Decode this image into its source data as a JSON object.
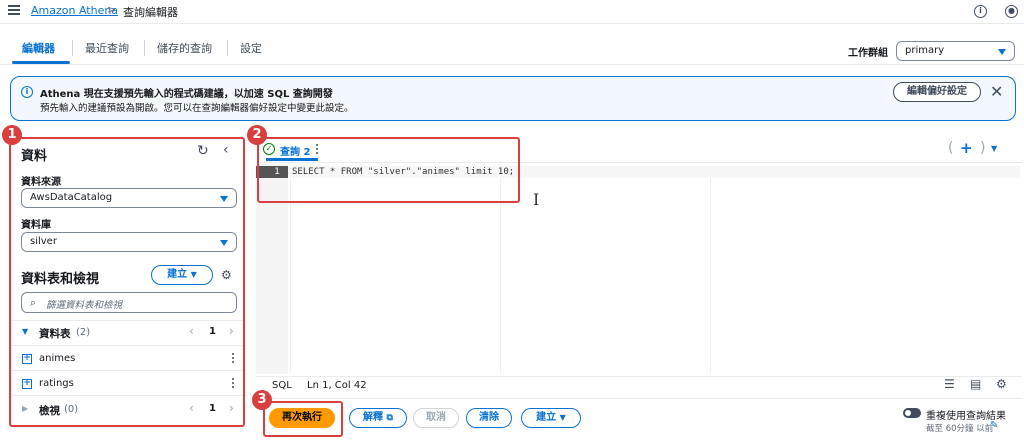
{
  "breadcrumb": {
    "service": "Amazon Athena",
    "separator": ">",
    "current": "查詢編輯器"
  },
  "tabs": [
    {
      "label": "編輯器",
      "active": true
    },
    {
      "label": "最近查詢",
      "active": false
    },
    {
      "label": "儲存的查詢",
      "active": false
    },
    {
      "label": "設定",
      "active": false
    }
  ],
  "workgroup": {
    "label": "工作群組",
    "value": "primary"
  },
  "alert": {
    "title": "Athena 現在支援預先輸入的程式碼建議，以加速 SQL 查詢開發",
    "body": "預先輸入的建議預設為開啟。您可以在查詢編輯器偏好設定中變更此設定。",
    "button": "編輯偏好設定"
  },
  "data_panel": {
    "title": "資料",
    "datasource_label": "資料來源",
    "datasource_value": "AwsDataCatalog",
    "database_label": "資料庫",
    "database_value": "silver",
    "tables_views_heading": "資料表和檢視",
    "create_button": "建立",
    "filter_placeholder": "篩選資料表和檢視",
    "tables_section": {
      "label": "資料表",
      "count": "(2)",
      "page": "1"
    },
    "tables": [
      "animes",
      "ratings"
    ],
    "views_section": {
      "label": "檢視",
      "count": "(0)",
      "page": "1"
    }
  },
  "editor": {
    "tab_label": "查詢 2",
    "line_number": "1",
    "code": "SELECT * FROM \"silver\".\"animes\" limit 10;",
    "add_tab": "+",
    "language": "SQL",
    "cursor_position": "Ln 1, Col 42"
  },
  "actions": {
    "run_again": "再次執行",
    "explain": "解釋",
    "cancel": "取消",
    "clear": "清除",
    "create": "建立",
    "reuse_toggle_label": "重複使用查詢結果",
    "reuse_sub": "截至 60分鐘 以前"
  },
  "annotations": {
    "badge1": "1",
    "badge2": "2",
    "badge3": "3"
  },
  "colors": {
    "accent": "#0972d3",
    "run_button": "#ff9900",
    "annotation": "#d93f3f"
  }
}
